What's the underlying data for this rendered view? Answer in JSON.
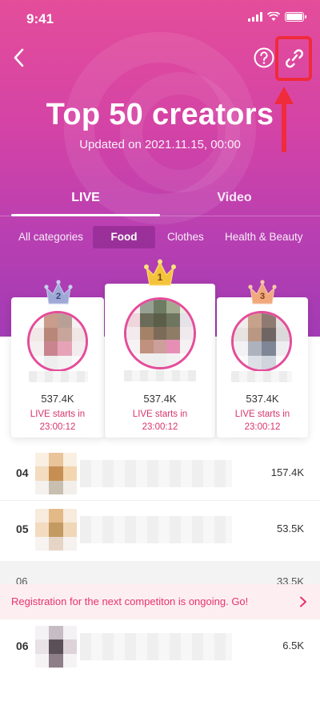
{
  "status_bar": {
    "time": "9:41"
  },
  "header": {
    "title": "Top 50 creators",
    "updated": "Updated on 2021.11.15, 00:00",
    "icons": {
      "back": "chevron-left-icon",
      "help": "question-icon",
      "link": "link-icon"
    }
  },
  "main_tabs": [
    {
      "label": "LIVE",
      "active": true
    },
    {
      "label": "Video",
      "active": false
    }
  ],
  "categories": [
    {
      "label": "All categories",
      "active": false
    },
    {
      "label": "Food",
      "active": true
    },
    {
      "label": "Clothes",
      "active": false
    },
    {
      "label": "Health & Beauty",
      "active": false
    }
  ],
  "podium": [
    {
      "rank": "2",
      "followers": "537.4K",
      "live_line1": "LIVE starts in",
      "live_line2": "23:00:12"
    },
    {
      "rank": "1",
      "followers": "537.4K",
      "live_line1": "LIVE starts in",
      "live_line2": "23:00:12"
    },
    {
      "rank": "3",
      "followers": "537.4K",
      "live_line1": "LIVE starts in",
      "live_line2": "23:00:12"
    }
  ],
  "ranking": [
    {
      "rank": "04",
      "value": "157.4K"
    },
    {
      "rank": "05",
      "value": "53.5K"
    },
    {
      "rank": "06",
      "value": "6.5K"
    }
  ],
  "partial_row": {
    "rank": "06",
    "value": "33.5K"
  },
  "banner": {
    "text": "Registration for the next competiton is ongoing. Go!"
  },
  "colors": {
    "accent": "#e44d9a",
    "live_text": "#d6336c",
    "annotation": "#ef2b3c",
    "gold": "#f5c33b",
    "silver": "#9ea9d6",
    "bronze": "#f0a87c"
  }
}
